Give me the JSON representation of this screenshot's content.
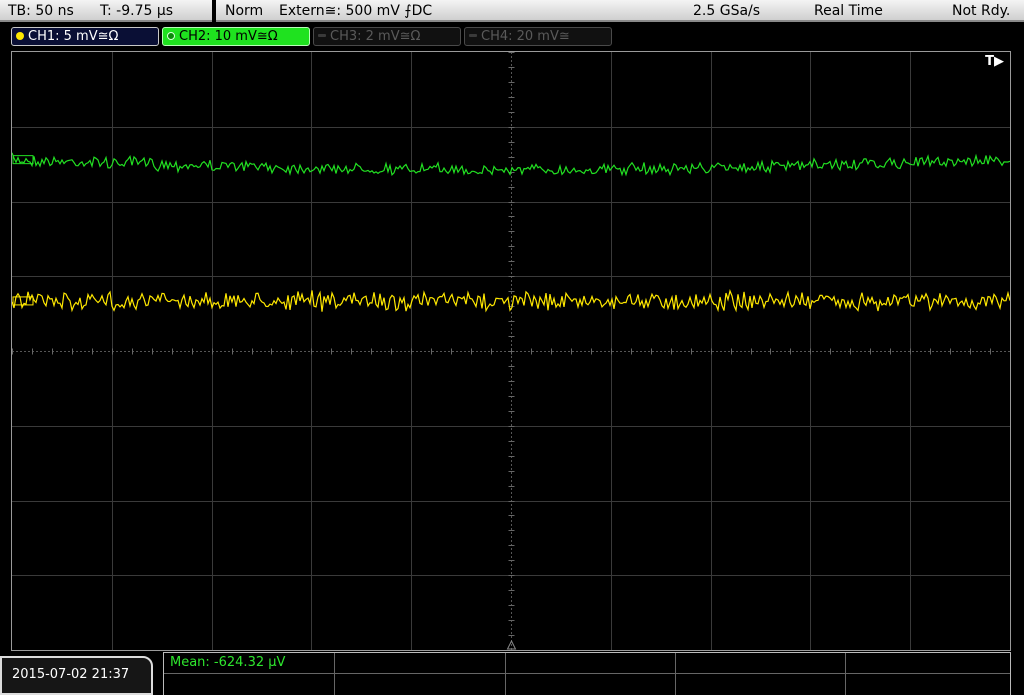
{
  "timebase": {
    "tb_label": "TB: 50 ns",
    "trigger_time_label": "T: -9.75 µs"
  },
  "trigger": {
    "mode": "Norm",
    "source": "Extern≅: 500 mV ⨍DC",
    "sample_rate": "2.5 GSa/s",
    "acquisition_mode": "Real Time",
    "status": "Not Rdy."
  },
  "channels": [
    {
      "label": "CH1: 5 mV≅Ω",
      "state": "active",
      "color": "#ffe800"
    },
    {
      "label": "CH2: 10 mV≅Ω",
      "state": "selected",
      "color": "#22e022"
    },
    {
      "label": "CH3: 2 mV≅Ω",
      "state": "off",
      "color": "#3a3a3a"
    },
    {
      "label": "CH4: 20 mV≅",
      "state": "off",
      "color": "#3a3a3a"
    }
  ],
  "display": {
    "trigger_position_marker": "T▶",
    "grid_divisions": {
      "horizontal": 10,
      "vertical": 8
    },
    "traces": [
      {
        "channel": "CH2",
        "color": "#22e022",
        "level_div": 1.44
      },
      {
        "channel": "CH1",
        "color": "#ffe800",
        "level_div": 3.33
      }
    ]
  },
  "footer": {
    "datetime": "2015-07-02 21:37",
    "measurement": "Mean: -624.32 µV"
  }
}
